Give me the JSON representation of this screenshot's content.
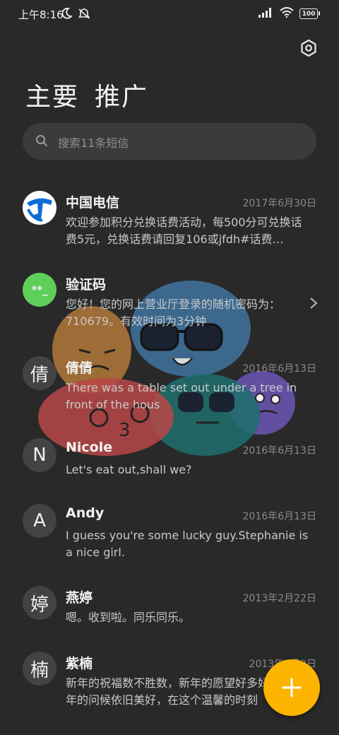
{
  "status": {
    "time": "上午8:16",
    "battery": "100"
  },
  "tabs": [
    "主要",
    "推广"
  ],
  "search": {
    "placeholder": "搜索11条短信"
  },
  "messages": [
    {
      "avatar": "",
      "sender": "中国电信",
      "date": "2017年6月30日",
      "preview": "欢迎参加积分兑换话费活动，每500分可兑换话费5元，兑换话费请回复106或jfdh#话费…"
    },
    {
      "avatar": "**_",
      "sender": "验证码",
      "date": "",
      "preview": "您好！您的网上营业厅登录的随机密码为：710679。有效时间为3分钟"
    },
    {
      "avatar": "倩",
      "sender": "倩倩",
      "date": "2016年6月13日",
      "preview": "There was a table set out under a tree in front of the hous"
    },
    {
      "avatar": "N",
      "sender": "Nicole",
      "date": "2016年6月13日",
      "preview": "Let's eat out,shall we?"
    },
    {
      "avatar": "A",
      "sender": "Andy",
      "date": "2016年6月13日",
      "preview": "I guess you're some lucky guy.Stephanie is a nice girl."
    },
    {
      "avatar": "婷",
      "sender": "燕婷",
      "date": "2013年2月22日",
      "preview": "嗯。收到啦。同乐同乐。"
    },
    {
      "avatar": "楠",
      "sender": "紫楠",
      "date": "2013年2月2日",
      "preview": "新年的祝福数不胜数，新年的愿望好多好多，新年的问候依旧美好，在这个温馨的时刻"
    }
  ],
  "colors": {
    "background": "#292929",
    "accent": "#fcb400",
    "telecom_blue": "#0e6bd6",
    "verify_green": "#5ed05a"
  }
}
